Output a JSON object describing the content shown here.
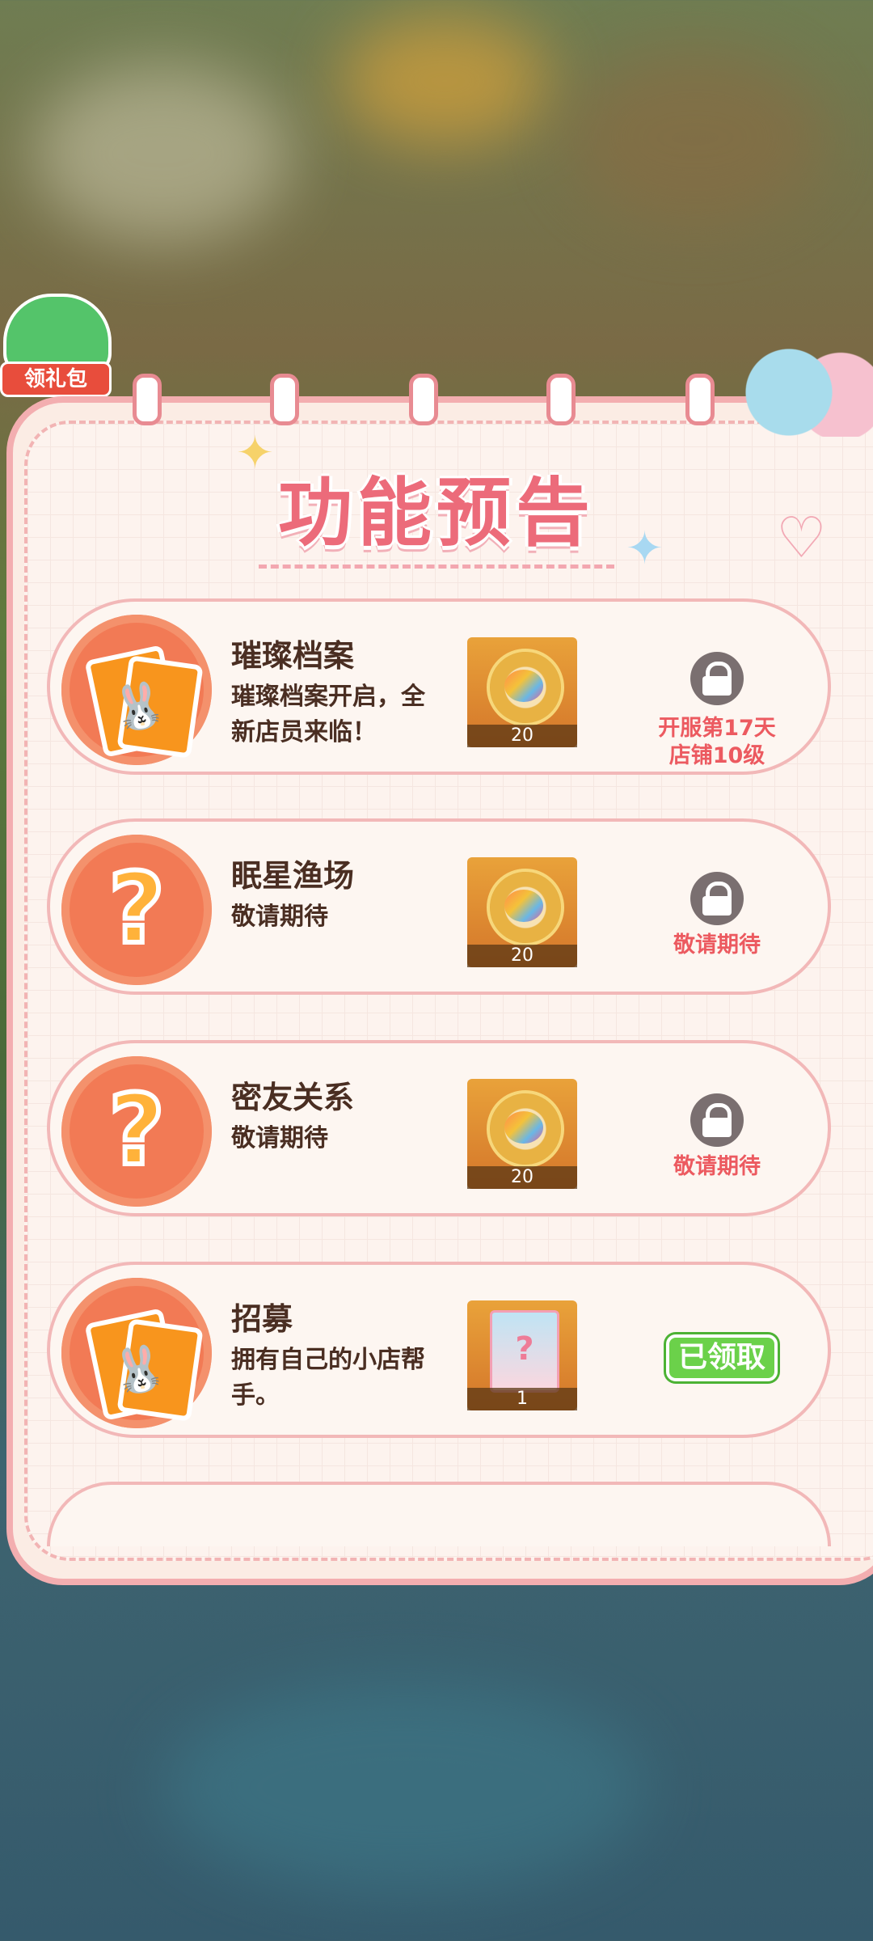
{
  "gift_label": "领礼包",
  "panel_title": "功能预告",
  "features": [
    {
      "name": "璀璨档案",
      "desc": "璀璨档案开启，全新店员来临！",
      "reward_count": "20",
      "status": "开服第17天\n店铺10级",
      "locked": true,
      "icon": "card-icon"
    },
    {
      "name": "眠星渔场",
      "desc": "敬请期待",
      "reward_count": "20",
      "status": "敬请期待",
      "locked": true,
      "icon": "question-icon"
    },
    {
      "name": "密友关系",
      "desc": "敬请期待",
      "reward_count": "20",
      "status": "敬请期待",
      "locked": true,
      "icon": "question-icon"
    },
    {
      "name": "招募",
      "desc": "拥有自己的小店帮手。",
      "reward_count": "1",
      "status": "已领取",
      "locked": false,
      "icon": "card-icon"
    }
  ]
}
